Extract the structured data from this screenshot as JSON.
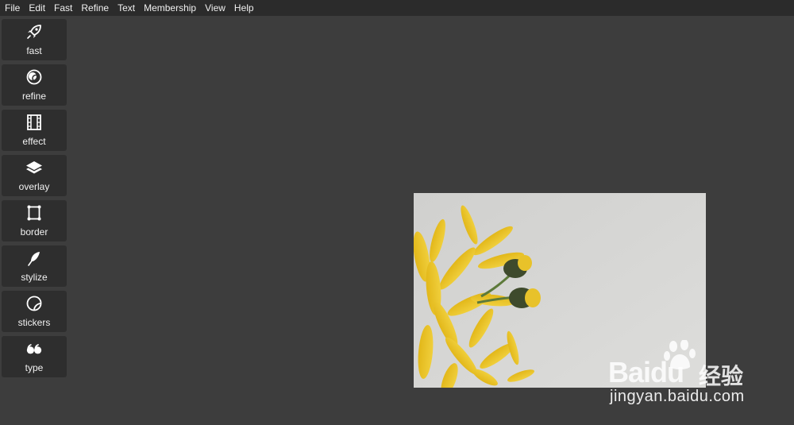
{
  "menu": {
    "items": [
      {
        "label": "File"
      },
      {
        "label": "Edit"
      },
      {
        "label": "Fast"
      },
      {
        "label": "Refine"
      },
      {
        "label": "Text"
      },
      {
        "label": "Membership"
      },
      {
        "label": "View"
      },
      {
        "label": "Help"
      }
    ]
  },
  "tools": {
    "items": [
      {
        "label": "fast",
        "icon": "rocket-icon"
      },
      {
        "label": "refine",
        "icon": "aperture-icon"
      },
      {
        "label": "effect",
        "icon": "film-icon"
      },
      {
        "label": "overlay",
        "icon": "layers-icon"
      },
      {
        "label": "border",
        "icon": "frame-icon"
      },
      {
        "label": "stylize",
        "icon": "feather-icon"
      },
      {
        "label": "stickers",
        "icon": "sticker-icon"
      },
      {
        "label": "type",
        "icon": "quote-icon"
      }
    ]
  },
  "watermark": {
    "logo": "Baidu",
    "cn": "经验",
    "url": "jingyan.baidu.com"
  },
  "colors": {
    "background": "#3d3d3d",
    "menubar": "#2b2b2b",
    "tool": "#2e2e2e",
    "petal": "#e8c22a"
  }
}
